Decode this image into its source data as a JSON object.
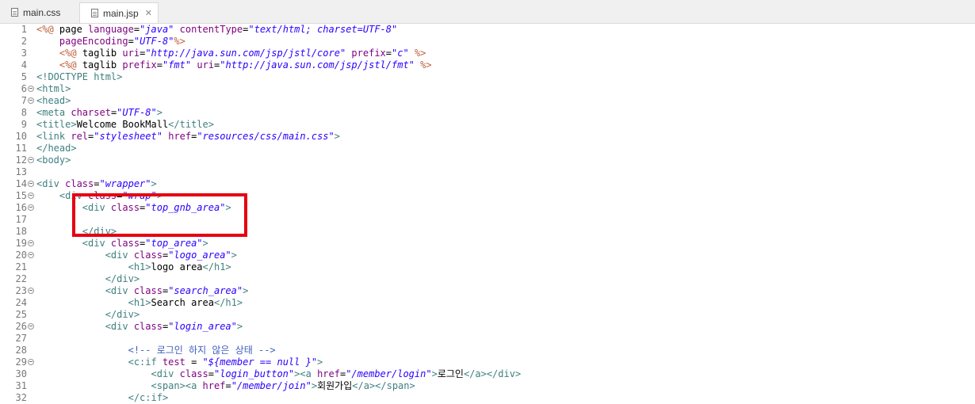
{
  "tabs": [
    {
      "label": "main.css",
      "active": false
    },
    {
      "label": "main.jsp",
      "active": true,
      "close": "✕"
    }
  ],
  "lines": [
    {
      "n": "1",
      "fold": false,
      "segs": [
        [
          "dr",
          "<%@ "
        ],
        [
          "tx",
          "page "
        ],
        [
          "at",
          "language"
        ],
        [
          "tx",
          "="
        ],
        [
          "st",
          "\"java\""
        ],
        [
          "tx",
          " "
        ],
        [
          "at",
          "contentType"
        ],
        [
          "tx",
          "="
        ],
        [
          "st",
          "\"text/html; charset=UTF-8\""
        ]
      ]
    },
    {
      "n": "2",
      "fold": false,
      "segs": [
        [
          "tx",
          "    "
        ],
        [
          "at",
          "pageEncoding"
        ],
        [
          "tx",
          "="
        ],
        [
          "st",
          "\"UTF-8\""
        ],
        [
          "dr",
          "%>"
        ]
      ]
    },
    {
      "n": "3",
      "fold": false,
      "segs": [
        [
          "tx",
          "    "
        ],
        [
          "dr",
          "<%@ "
        ],
        [
          "tx",
          "taglib "
        ],
        [
          "at",
          "uri"
        ],
        [
          "tx",
          "="
        ],
        [
          "st",
          "\"http://java.sun.com/jsp/jstl/core\""
        ],
        [
          "tx",
          " "
        ],
        [
          "at",
          "prefix"
        ],
        [
          "tx",
          "="
        ],
        [
          "st",
          "\"c\""
        ],
        [
          "tx",
          " "
        ],
        [
          "dr",
          "%>"
        ]
      ]
    },
    {
      "n": "4",
      "fold": false,
      "segs": [
        [
          "tx",
          "    "
        ],
        [
          "dr",
          "<%@ "
        ],
        [
          "tx",
          "taglib "
        ],
        [
          "at",
          "prefix"
        ],
        [
          "tx",
          "="
        ],
        [
          "st",
          "\"fmt\""
        ],
        [
          "tx",
          " "
        ],
        [
          "at",
          "uri"
        ],
        [
          "tx",
          "="
        ],
        [
          "st",
          "\"http://java.sun.com/jsp/jstl/fmt\""
        ],
        [
          "tx",
          " "
        ],
        [
          "dr",
          "%>"
        ]
      ]
    },
    {
      "n": "5",
      "fold": false,
      "segs": [
        [
          "tg",
          "<!DOCTYPE html>"
        ]
      ]
    },
    {
      "n": "6",
      "fold": true,
      "segs": [
        [
          "tg",
          "<html>"
        ]
      ]
    },
    {
      "n": "7",
      "fold": true,
      "segs": [
        [
          "tg",
          "<head>"
        ]
      ]
    },
    {
      "n": "8",
      "fold": false,
      "segs": [
        [
          "tg",
          "<meta "
        ],
        [
          "at",
          "charset"
        ],
        [
          "tx",
          "="
        ],
        [
          "st",
          "\"UTF-8\""
        ],
        [
          "tg",
          ">"
        ]
      ]
    },
    {
      "n": "9",
      "fold": false,
      "segs": [
        [
          "tg",
          "<title>"
        ],
        [
          "tx",
          "Welcome BookMall"
        ],
        [
          "tg",
          "</title>"
        ]
      ]
    },
    {
      "n": "10",
      "fold": false,
      "segs": [
        [
          "tg",
          "<link "
        ],
        [
          "at",
          "rel"
        ],
        [
          "tx",
          "="
        ],
        [
          "st",
          "\"stylesheet\""
        ],
        [
          "tx",
          " "
        ],
        [
          "at",
          "href"
        ],
        [
          "tx",
          "="
        ],
        [
          "st",
          "\"resources/css/main.css\""
        ],
        [
          "tg",
          ">"
        ]
      ]
    },
    {
      "n": "11",
      "fold": false,
      "segs": [
        [
          "tg",
          "</head>"
        ]
      ]
    },
    {
      "n": "12",
      "fold": true,
      "segs": [
        [
          "tg",
          "<body>"
        ]
      ]
    },
    {
      "n": "13",
      "fold": false,
      "segs": []
    },
    {
      "n": "14",
      "fold": true,
      "segs": [
        [
          "tg",
          "<div "
        ],
        [
          "at",
          "class"
        ],
        [
          "tx",
          "="
        ],
        [
          "st",
          "\"wrapper\""
        ],
        [
          "tg",
          ">"
        ]
      ]
    },
    {
      "n": "15",
      "fold": true,
      "segs": [
        [
          "tx",
          "    "
        ],
        [
          "tg",
          "<div "
        ],
        [
          "at",
          "class"
        ],
        [
          "tx",
          "="
        ],
        [
          "st",
          "\"wrap\""
        ],
        [
          "tg",
          ">"
        ]
      ]
    },
    {
      "n": "16",
      "fold": true,
      "segs": [
        [
          "tx",
          "        "
        ],
        [
          "tg",
          "<div "
        ],
        [
          "at",
          "class"
        ],
        [
          "tx",
          "="
        ],
        [
          "st",
          "\"top_gnb_area\""
        ],
        [
          "tg",
          ">"
        ]
      ]
    },
    {
      "n": "17",
      "fold": false,
      "segs": []
    },
    {
      "n": "18",
      "fold": false,
      "segs": [
        [
          "tx",
          "        "
        ],
        [
          "tg",
          "</div>"
        ]
      ]
    },
    {
      "n": "19",
      "fold": true,
      "segs": [
        [
          "tx",
          "        "
        ],
        [
          "tg",
          "<div "
        ],
        [
          "at",
          "class"
        ],
        [
          "tx",
          "="
        ],
        [
          "st",
          "\"top_area\""
        ],
        [
          "tg",
          ">"
        ]
      ]
    },
    {
      "n": "20",
      "fold": true,
      "segs": [
        [
          "tx",
          "            "
        ],
        [
          "tg",
          "<div "
        ],
        [
          "at",
          "class"
        ],
        [
          "tx",
          "="
        ],
        [
          "st",
          "\"logo_area\""
        ],
        [
          "tg",
          ">"
        ]
      ]
    },
    {
      "n": "21",
      "fold": false,
      "segs": [
        [
          "tx",
          "                "
        ],
        [
          "tg",
          "<h1>"
        ],
        [
          "tx",
          "logo area"
        ],
        [
          "tg",
          "</h1>"
        ]
      ]
    },
    {
      "n": "22",
      "fold": false,
      "segs": [
        [
          "tx",
          "            "
        ],
        [
          "tg",
          "</div>"
        ]
      ]
    },
    {
      "n": "23",
      "fold": true,
      "segs": [
        [
          "tx",
          "            "
        ],
        [
          "tg",
          "<div "
        ],
        [
          "at",
          "class"
        ],
        [
          "tx",
          "="
        ],
        [
          "st",
          "\"search_area\""
        ],
        [
          "tg",
          ">"
        ]
      ]
    },
    {
      "n": "24",
      "fold": false,
      "segs": [
        [
          "tx",
          "                "
        ],
        [
          "tg",
          "<h1>"
        ],
        [
          "tx",
          "Search area"
        ],
        [
          "tg",
          "</h1>"
        ]
      ]
    },
    {
      "n": "25",
      "fold": false,
      "segs": [
        [
          "tx",
          "            "
        ],
        [
          "tg",
          "</div>"
        ]
      ]
    },
    {
      "n": "26",
      "fold": true,
      "segs": [
        [
          "tx",
          "            "
        ],
        [
          "tg",
          "<div "
        ],
        [
          "at",
          "class"
        ],
        [
          "tx",
          "="
        ],
        [
          "st",
          "\"login_area\""
        ],
        [
          "tg",
          ">"
        ]
      ]
    },
    {
      "n": "27",
      "fold": false,
      "segs": []
    },
    {
      "n": "28",
      "fold": false,
      "segs": [
        [
          "tx",
          "                "
        ],
        [
          "cm",
          "<!-- 로그인 하지 않은 상태 -->"
        ]
      ]
    },
    {
      "n": "29",
      "fold": true,
      "segs": [
        [
          "tx",
          "                "
        ],
        [
          "tg",
          "<c:if "
        ],
        [
          "at",
          "test"
        ],
        [
          "tx",
          " = "
        ],
        [
          "st",
          "\"${member == null }\""
        ],
        [
          "tg",
          ">"
        ]
      ]
    },
    {
      "n": "30",
      "fold": false,
      "segs": [
        [
          "tx",
          "                    "
        ],
        [
          "tg",
          "<div "
        ],
        [
          "at",
          "class"
        ],
        [
          "tx",
          "="
        ],
        [
          "st",
          "\"login_button\""
        ],
        [
          "tg",
          ">"
        ],
        [
          "tg",
          "<a "
        ],
        [
          "at",
          "href"
        ],
        [
          "tx",
          "="
        ],
        [
          "st",
          "\"/member/login\""
        ],
        [
          "tg",
          ">"
        ],
        [
          "tx",
          "로그인"
        ],
        [
          "tg",
          "</a></div>"
        ]
      ]
    },
    {
      "n": "31",
      "fold": false,
      "segs": [
        [
          "tx",
          "                    "
        ],
        [
          "tg",
          "<span>"
        ],
        [
          "tg",
          "<a "
        ],
        [
          "at",
          "href"
        ],
        [
          "tx",
          "="
        ],
        [
          "st",
          "\"/member/join\""
        ],
        [
          "tg",
          ">"
        ],
        [
          "tx",
          "회원가입"
        ],
        [
          "tg",
          "</a></span>"
        ]
      ]
    },
    {
      "n": "32",
      "fold": false,
      "segs": [
        [
          "tx",
          "                "
        ],
        [
          "tg",
          "</c:if>"
        ]
      ]
    }
  ]
}
